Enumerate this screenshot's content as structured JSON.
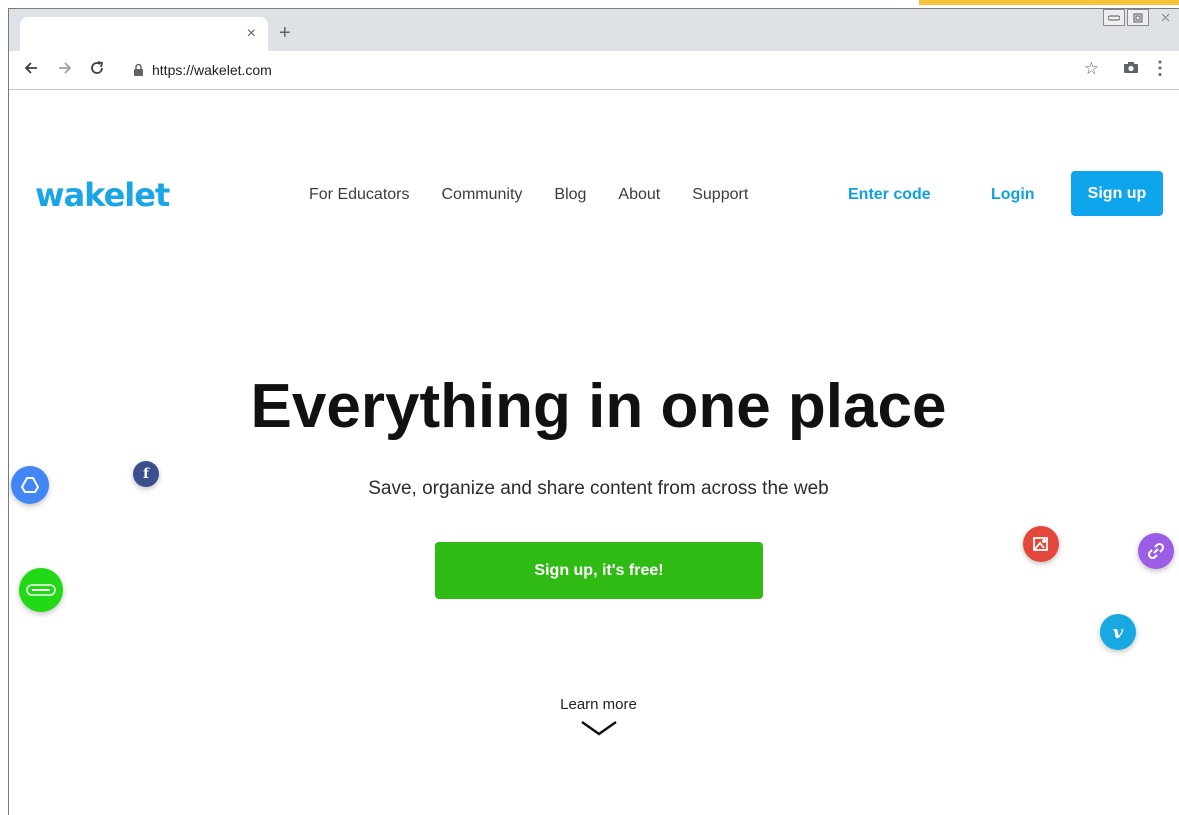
{
  "browser": {
    "tab": {
      "close_glyph": "×"
    },
    "new_tab_glyph": "+",
    "url": "https://wakelet.com",
    "icons": {
      "back": "back-arrow-icon",
      "forward": "forward-arrow-icon",
      "reload": "reload-icon",
      "lock": "lock-icon",
      "bookmark": "star-icon",
      "camera": "camera-icon",
      "menu": "kebab-menu-icon"
    },
    "window_controls": [
      "minimize",
      "restore",
      "close"
    ]
  },
  "site": {
    "logo_text": "wakelet",
    "nav": [
      {
        "label": "For Educators"
      },
      {
        "label": "Community"
      },
      {
        "label": "Blog"
      },
      {
        "label": "About"
      },
      {
        "label": "Support"
      }
    ],
    "enter_code_label": "Enter code",
    "login_label": "Login",
    "signup_label": "Sign up"
  },
  "hero": {
    "title": "Everything in one place",
    "subtitle": "Save, organize and share content from across the web",
    "cta_label": "Sign up, it's free!",
    "learn_more_label": "Learn more"
  },
  "floating_icons": [
    {
      "name": "google-drive-icon",
      "color": "#4285f4"
    },
    {
      "name": "facebook-icon",
      "color": "#3b4f8f",
      "glyph": "f"
    },
    {
      "name": "flipgrid-icon",
      "color": "#22d916"
    },
    {
      "name": "image-icon",
      "color": "#e2473a"
    },
    {
      "name": "link-icon",
      "color": "#9b5ce6"
    },
    {
      "name": "vimeo-icon",
      "color": "#19a9e1",
      "glyph": "v"
    }
  ],
  "colors": {
    "brand_blue": "#1aa5e6",
    "cta_green": "#2fbb14",
    "signup_blue": "#0fa5ec"
  }
}
